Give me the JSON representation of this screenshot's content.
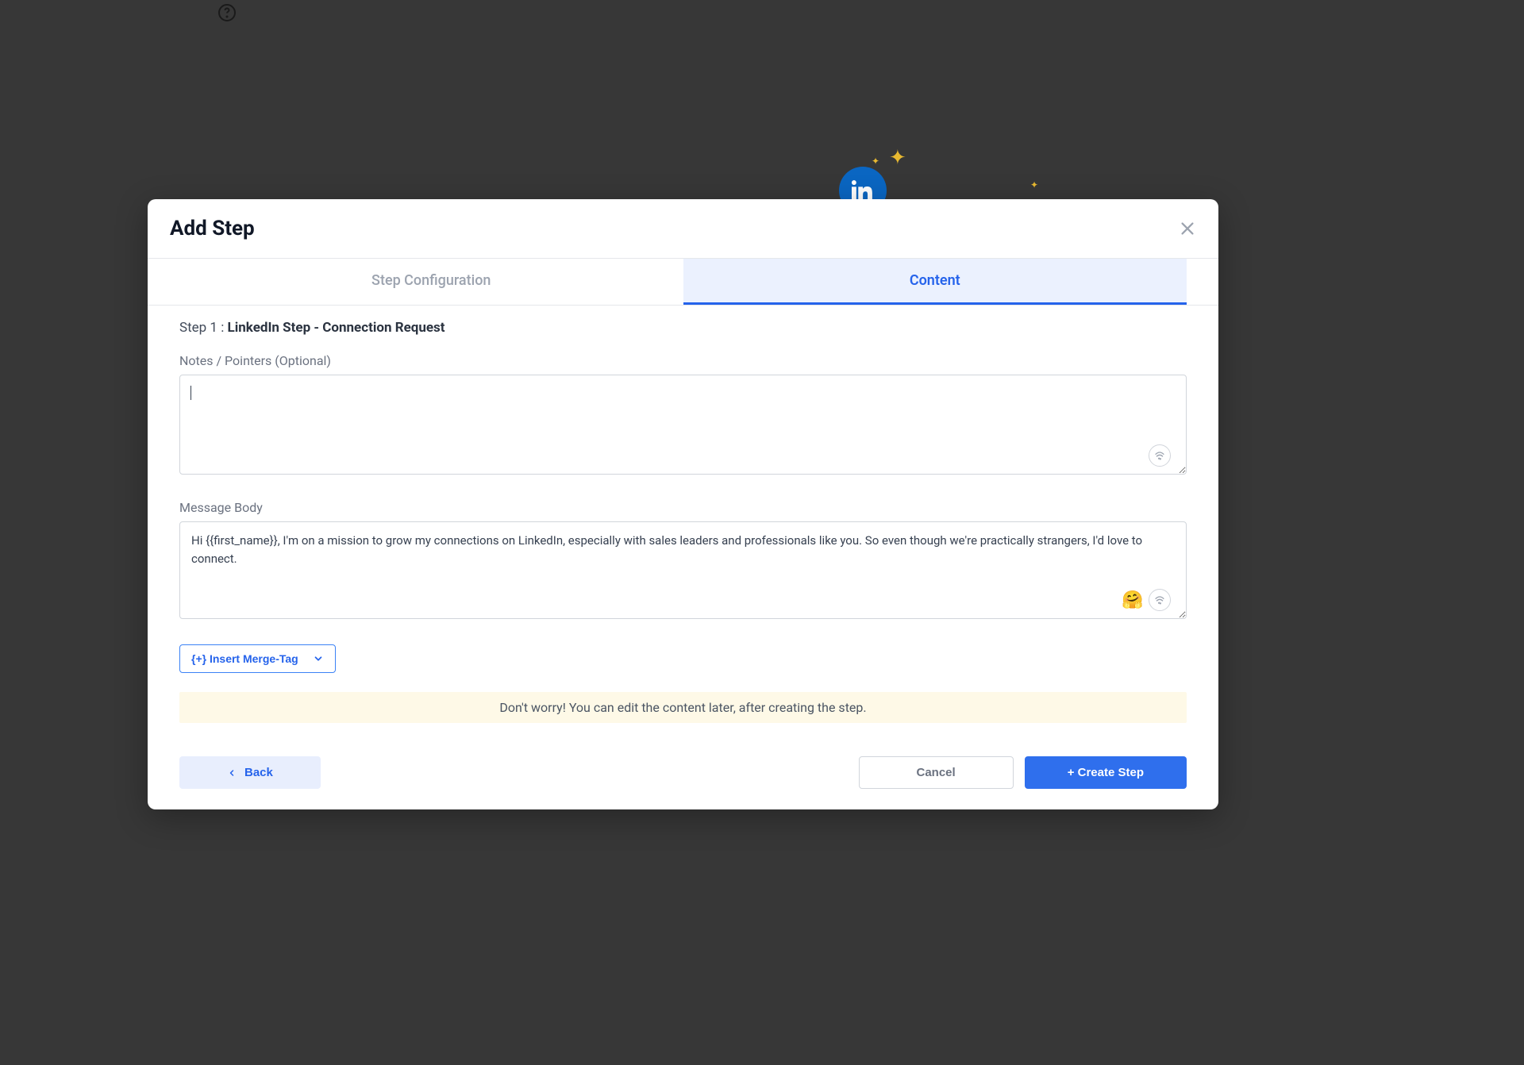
{
  "modal": {
    "title": "Add Step",
    "tabs": {
      "config": "Step Configuration",
      "content": "Content"
    },
    "step_prefix": "Step 1 : ",
    "step_name": "LinkedIn Step - Connection Request",
    "notes": {
      "label": "Notes / Pointers (Optional)",
      "value": ""
    },
    "body": {
      "label": "Message Body",
      "value": "Hi {{first_name}}, I'm on a mission to grow my connections on LinkedIn, especially with sales leaders and professionals like you. So even though we're practically strangers, I'd love to connect."
    },
    "merge_tag_label": "{+} Insert Merge-Tag",
    "info_banner": "Don't worry! You can edit the content later, after creating the step.",
    "back_label": "Back",
    "cancel_label": "Cancel",
    "create_label": "+ Create Step"
  }
}
